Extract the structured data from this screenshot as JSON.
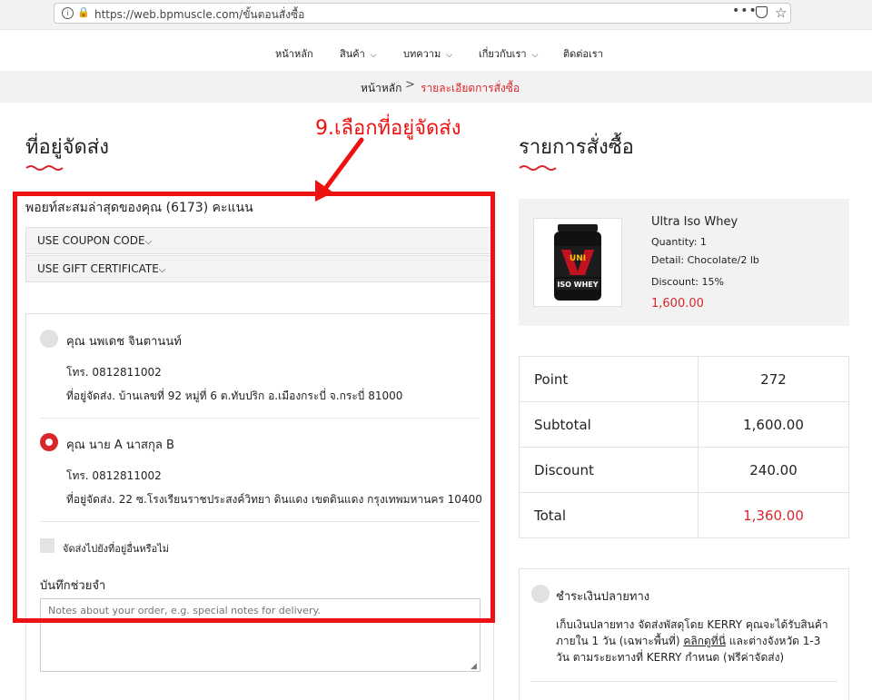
{
  "browser": {
    "url_host": "https://web.bpmuscle.com",
    "url_path": "/ขั้นตอนสั่งซื้อ"
  },
  "nav": {
    "items": [
      {
        "label": "หน้าหลัก"
      },
      {
        "label": "สินค้า"
      },
      {
        "label": "บทความ"
      },
      {
        "label": "เกี่ยวกับเรา"
      },
      {
        "label": "ติดต่อเรา"
      }
    ]
  },
  "breadcrumb": {
    "home": "หน้าหลัก",
    "separator": ">",
    "current": "รายละเอียดการสั่งซื้อ"
  },
  "annotation": {
    "text": "9.เลือกที่อยู่จัดส่ง",
    "color": "#ee1111"
  },
  "shipping": {
    "heading": "ที่อยู่จัดส่ง",
    "points_text": "พอยท์สะสมล่าสุดของคุณ (6173) คะแนน",
    "coupon_label": "USE COUPON CODE",
    "gift_label": "USE GIFT CERTIFICATE",
    "addresses": [
      {
        "name": "คุณ นพเดช จินตานนท์",
        "phone": "โทร. 0812811002",
        "address": "ที่อยู่จัดส่ง. บ้านเลขที่ 92 หมู่ที่ 6 ต.ทับปริก อ.เมืองกระบี่ จ.กระบี่ 81000",
        "selected": false
      },
      {
        "name": "คุณ นาย A นาสกุล B",
        "phone": "โทร. 0812811002",
        "address": "ที่อยู่จัดส่ง. 22 ซ.โรงเรียนราชประสงค์วิทยา ดินแดง เขตดินแดง กรุงเทพมหานคร 10400",
        "selected": true
      }
    ],
    "other_address_label": "จัดส่งไปยังที่อยู่อื่นหรือไม่",
    "notes_label": "บันทึกช่วยจำ",
    "notes_placeholder": "Notes about your order, e.g. special notes for delivery."
  },
  "order": {
    "heading": "รายการสั่งซื้อ",
    "product": {
      "title": "Ultra Iso Whey",
      "quantity": "Quantity: 1",
      "detail": "Detail: Chocolate/2 lb",
      "discount": "Discount: 15%",
      "price": "1,600.00",
      "image_text_brand": "UNI",
      "image_text_name": "ISO WHEY"
    },
    "summary": [
      {
        "label": "Point",
        "value": "272"
      },
      {
        "label": "Subtotal",
        "value": "1,600.00"
      },
      {
        "label": "Discount",
        "value": "240.00"
      },
      {
        "label": "Total",
        "value": "1,360.00"
      }
    ]
  },
  "payment": {
    "option_label": "ชำระเงินปลายทาง",
    "desc_part1": "เก็บเงินปลายทาง จัดส่งพัสดุโดย KERRY คุณจะได้รับสินค้าภายใน 1 วัน (เฉพาะพื้นที่) ",
    "desc_link": "คลิกดูที่นี่",
    "desc_part2": " และต่างจังหวัด 1-3 วัน ตามระยะทางที่ KERRY กำหนด (ฟรีค่าจัดส่ง)"
  },
  "colors": {
    "accent_red": "#d9262c",
    "annotation_red": "#ee1111"
  }
}
